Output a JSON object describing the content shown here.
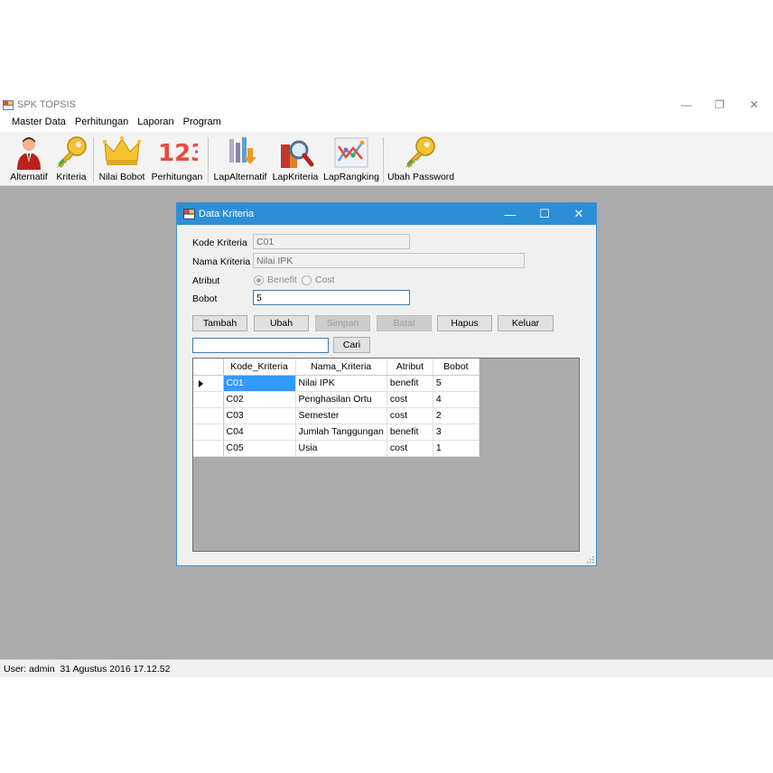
{
  "app": {
    "title": "SPK TOPSIS"
  },
  "window_controls": {
    "minimize": "—",
    "restore": "❐",
    "close": "✕"
  },
  "menu": [
    "Master Data",
    "Perhitungan",
    "Laporan",
    "Program"
  ],
  "toolbar": [
    {
      "label": "Alternatif",
      "icon": "person-icon"
    },
    {
      "label": "Kriteria",
      "icon": "key-icon"
    },
    {
      "label": "Nilai Bobot",
      "icon": "crown-icon"
    },
    {
      "label": "Perhitungan",
      "icon": "numbers-123-icon"
    },
    {
      "label": "LapAlternatif",
      "icon": "report-list-icon"
    },
    {
      "label": "LapKriteria",
      "icon": "book-magnifier-icon"
    },
    {
      "label": "LapRangking",
      "icon": "line-chart-icon"
    },
    {
      "label": "Ubah Password",
      "icon": "key-icon"
    }
  ],
  "toolbar_icon_text": {
    "numbers": "123"
  },
  "status": {
    "text": "User: admin  31 Agustus 2016 17.12.52"
  },
  "dialog": {
    "title": "Data Kriteria",
    "controls": {
      "minimize": "—",
      "maximize": "☐",
      "close": "✕"
    },
    "fields": {
      "kode_label": "Kode Kriteria",
      "kode_value": "C01",
      "nama_label": "Nama Kriteria",
      "nama_value": "Nilai IPK",
      "atribut_label": "Atribut",
      "atribut_options": [
        "Benefit",
        "Cost"
      ],
      "atribut_selected": "Benefit",
      "bobot_label": "Bobot",
      "bobot_value": "5"
    },
    "buttons": {
      "tambah": "Tambah",
      "ubah": "Ubah",
      "simpan": "Simpan",
      "batal": "Batal",
      "hapus": "Hapus",
      "keluar": "Keluar"
    },
    "search": {
      "value": "",
      "button": "Cari"
    },
    "table": {
      "columns": [
        "Kode_Kriteria",
        "Nama_Kriteria",
        "Atribut",
        "Bobot"
      ],
      "rows": [
        [
          "C01",
          "Nilai IPK",
          "benefit",
          "5"
        ],
        [
          "C02",
          "Penghasilan Ortu",
          "cost",
          "4"
        ],
        [
          "C03",
          "Semester",
          "cost",
          "2"
        ],
        [
          "C04",
          "Jumlah Tanggungan",
          "benefit",
          "3"
        ],
        [
          "C05",
          "Usia",
          "cost",
          "1"
        ]
      ]
    }
  }
}
